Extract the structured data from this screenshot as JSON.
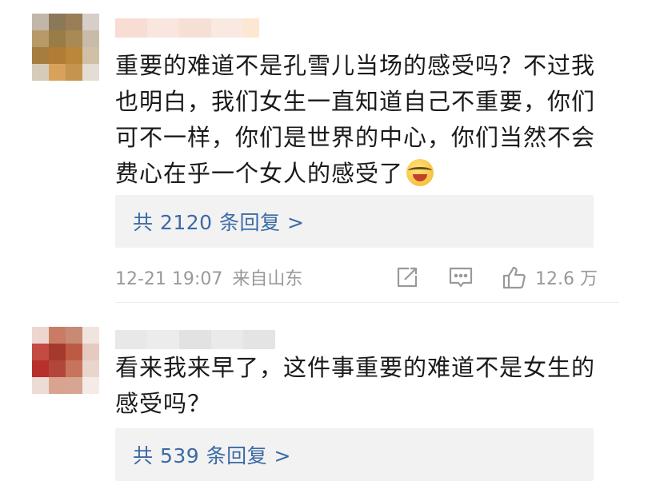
{
  "comments": [
    {
      "text_lines": [
        "重要的难道不是孔雪儿当场的感受吗？不过我",
        "也明白，我们女生一直知道自己不重要，你们",
        "可不一样，你们是世界的中心，你们当然不会",
        "费心在乎一个女人的感受了"
      ],
      "emoji": "laugh-cry-emoji",
      "replies_label": "共 2120 条回复 >",
      "timestamp": "12-21 19:07",
      "source": "来自山东",
      "likes": "12.6 万",
      "colors": {
        "avatar": [
          "#c2b6a9",
          "#8a7858",
          "#9a7e58",
          "#d6cfc8",
          "#b79a67",
          "#9a7c46",
          "#a88a55",
          "#c8bba9",
          "#a67d3e",
          "#b07c36",
          "#b98839",
          "#cfc0a6",
          "#d6cbb9",
          "#d9a25a",
          "#c49450",
          "#e4ddd3"
        ]
      }
    },
    {
      "text_lines": [
        "看来我来早了，这件事重要的难道不是女生的",
        "感受吗？"
      ],
      "replies_label": "共 539 条回复 >",
      "colors": {
        "avatar": [
          "#ecd6cf",
          "#c97c63",
          "#c88a74",
          "#f1e4de",
          "#c44a44",
          "#a5392f",
          "#bd5a44",
          "#e6c9bf",
          "#b8302c",
          "#b3463a",
          "#c7745c",
          "#ead5cd",
          "#eddcd6",
          "#d9a38f",
          "#d8a493",
          "#f4ebe7"
        ]
      }
    }
  ],
  "accent_color": "#3c6aa6"
}
